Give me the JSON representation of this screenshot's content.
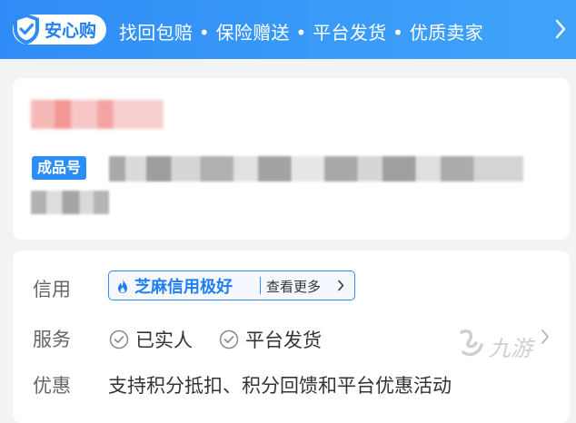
{
  "banner": {
    "brand": "安心购",
    "features": "找回包赔 • 保险赠送 • 平台发货 • 优质卖家",
    "shield_icon": "shield-check-icon",
    "arrow_icon": "chevron-right-icon",
    "color": "#2f8cf6"
  },
  "product": {
    "id_tag": "成品号"
  },
  "info": {
    "credit_label": "信用",
    "credit_badge": "芝麻信用极好",
    "credit_more": "查看更多",
    "service_label": "服务",
    "services": [
      "已实人",
      "平台发货"
    ],
    "promo_label": "优惠",
    "promo_text": "支持积分抵扣、积分回馈和平台优惠活动"
  },
  "watermark": "九游"
}
